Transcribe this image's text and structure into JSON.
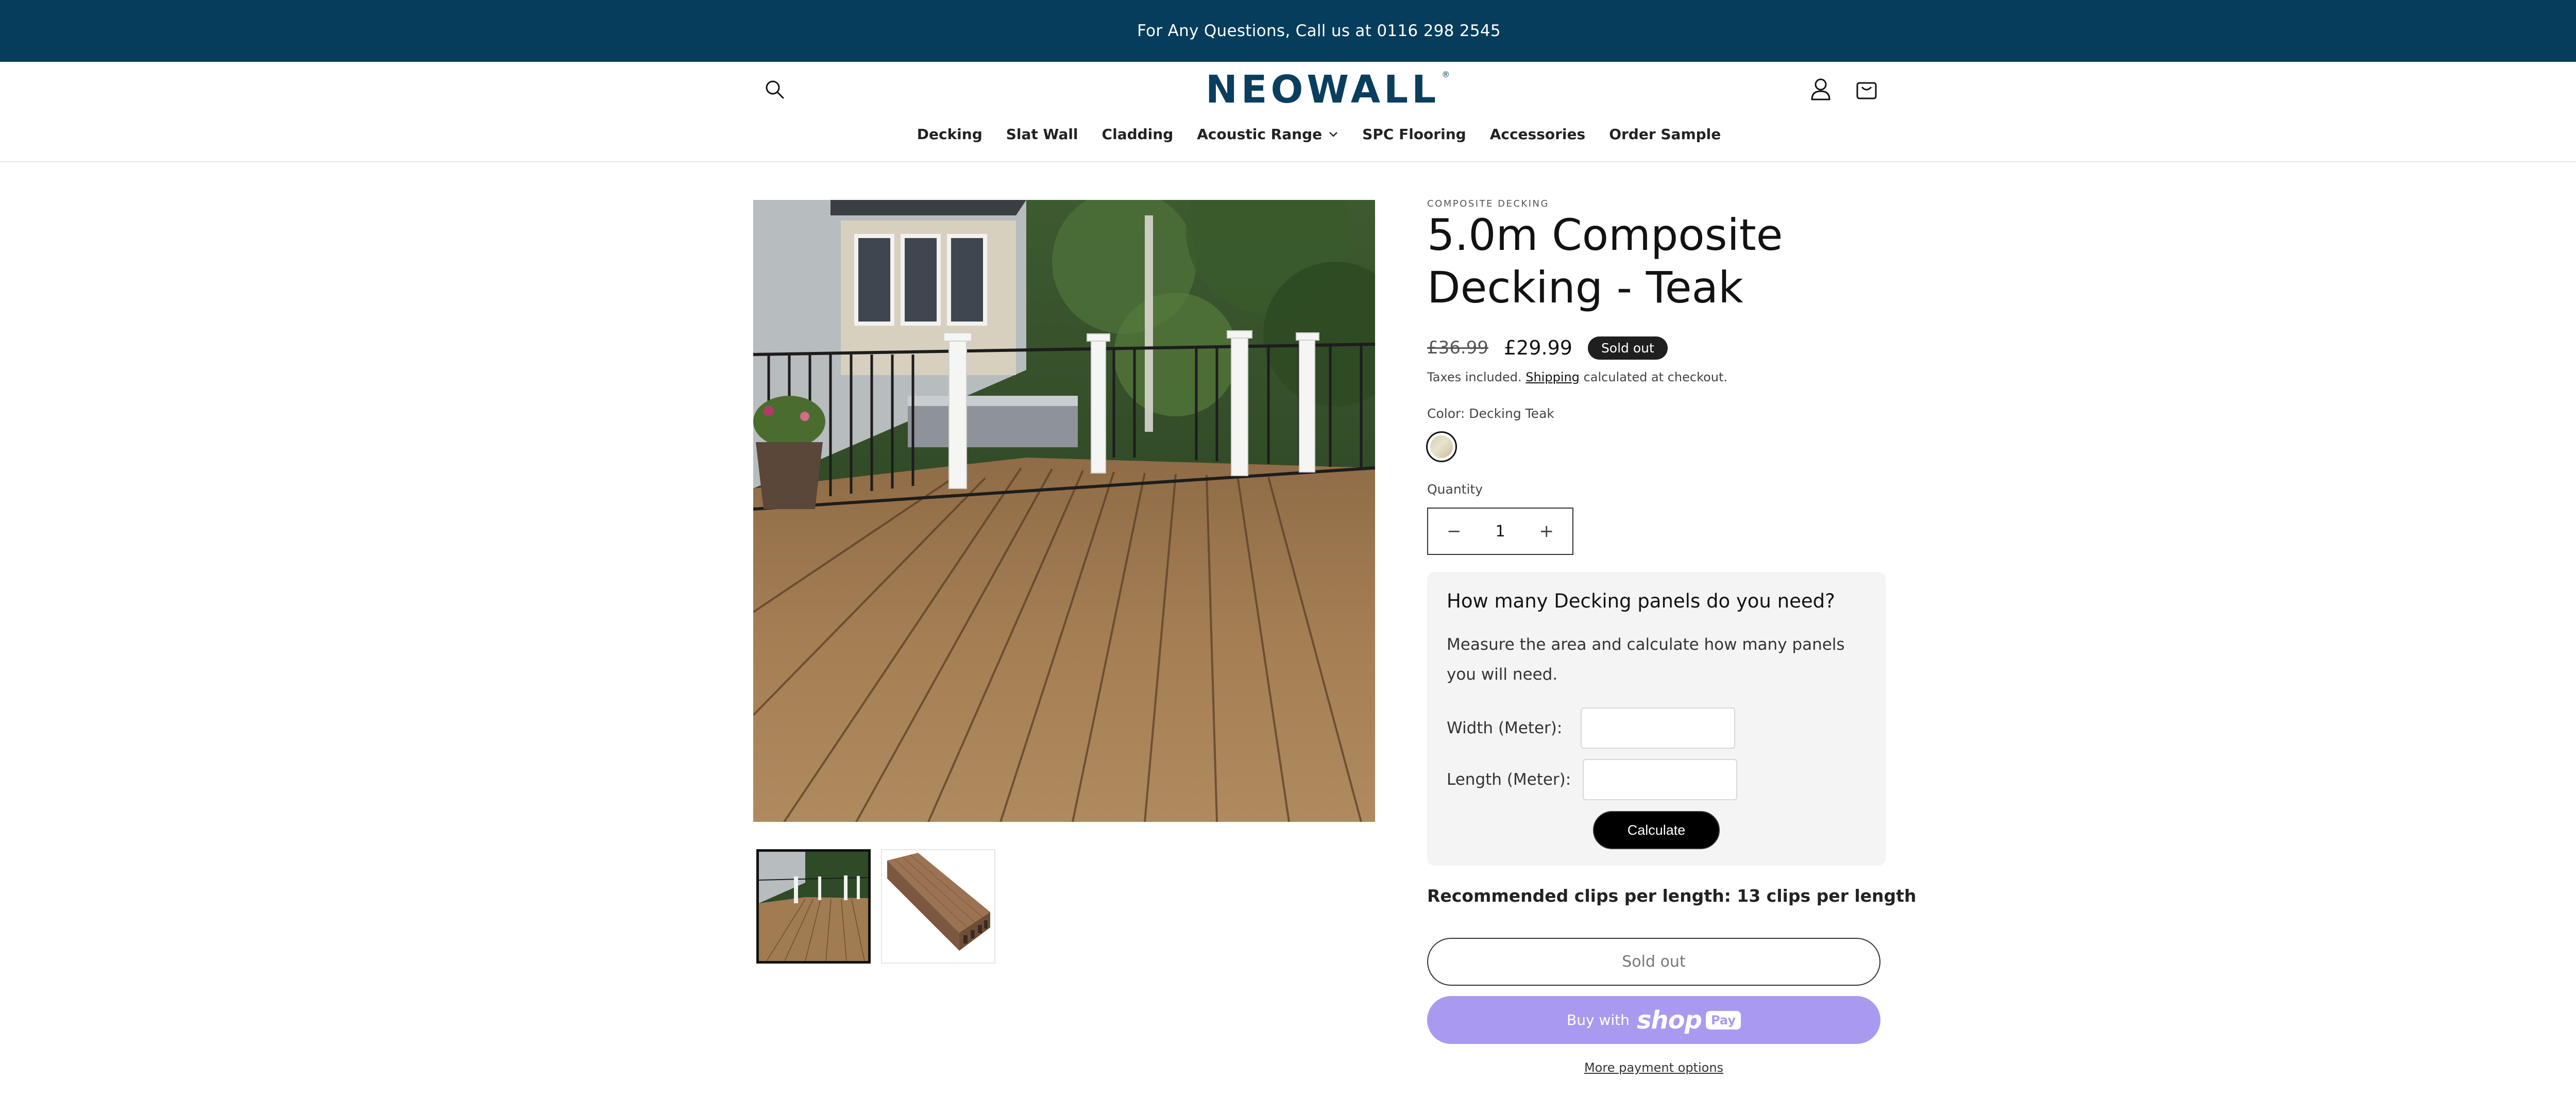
{
  "announcement": "For Any Questions, Call us at 0116 298 2545",
  "header": {
    "logo_text": "NEOWALL",
    "logo_mark": "®",
    "icons": [
      "search-icon",
      "account-icon",
      "cart-icon"
    ]
  },
  "nav": {
    "items": [
      "Decking",
      "Slat Wall",
      "Cladding",
      "Acoustic Range",
      "SPC Flooring",
      "Accessories",
      "Order Sample"
    ]
  },
  "product": {
    "vendor": "COMPOSITE DECKING",
    "title": "5.0m Composite Decking - Teak",
    "price_old": "£36.99",
    "price_new": "£29.99",
    "badge": "Sold out",
    "taxes_prefix": "Taxes included.",
    "taxes_link": "Shipping",
    "taxes_suffix": "calculated at checkout.",
    "color_label": "Color: Decking Teak",
    "quantity_label": "Quantity",
    "quantity_value": "1",
    "quantity_minus": "−",
    "quantity_plus": "+"
  },
  "calculator": {
    "heading": "How many Decking panels do you need?",
    "description": "Measure the area and calculate how many panels you will need.",
    "width_label": "Width (Meter):",
    "length_label": "Length (Meter):",
    "width_value": "",
    "length_value": "",
    "button": "Calculate"
  },
  "recommendation": "Recommended clips per length: 13 clips per length",
  "buttons": {
    "sold_out": "Sold out",
    "buy_with": "Buy with",
    "shop": "shop",
    "pay": "Pay",
    "more_payment": "More payment options"
  },
  "gallery": {
    "thumbnails": [
      "deck-scene-thumbnail",
      "board-profile-thumbnail"
    ],
    "selected_index": 0
  },
  "colors": {
    "announcement_bg": "#063d5c",
    "logo": "#0a3e5e",
    "shop_pay": "#a99af0",
    "badge_bg": "#1f1f1f"
  }
}
